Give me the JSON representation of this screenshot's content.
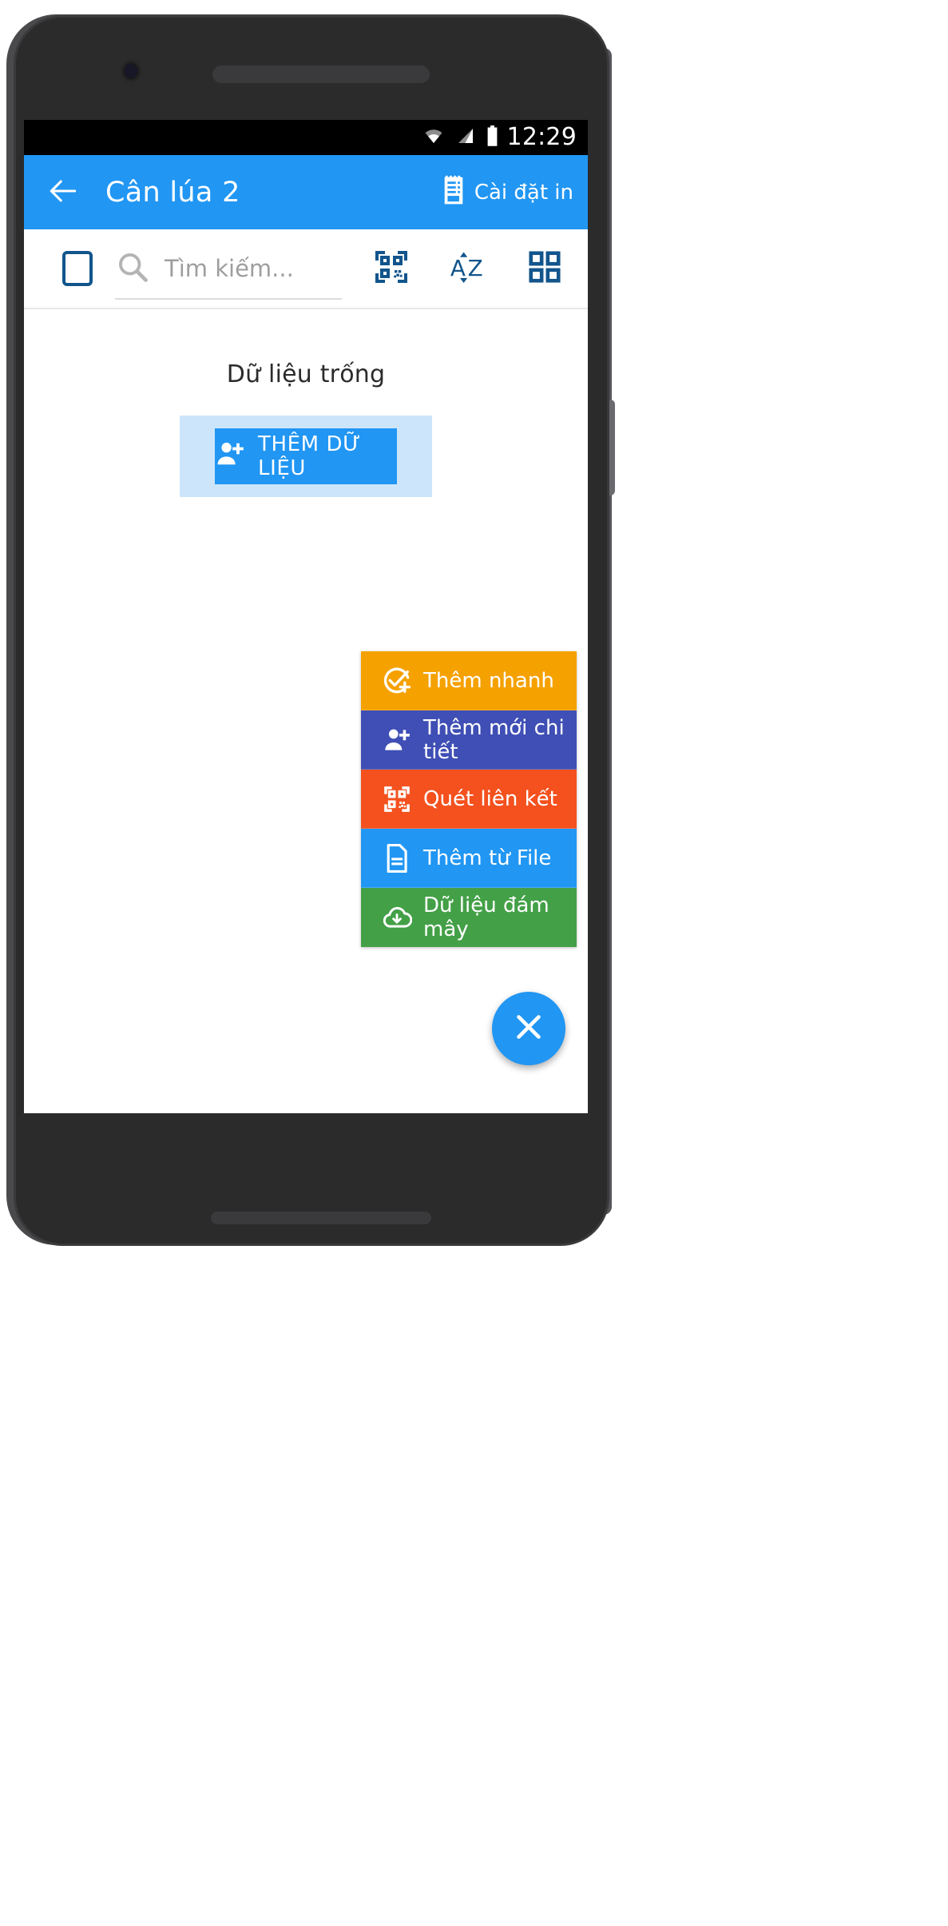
{
  "status_bar": {
    "time": "12:29",
    "icons": [
      "wifi-icon",
      "signal-icon",
      "battery-icon"
    ]
  },
  "app_bar": {
    "back_icon": "back-arrow-icon",
    "title": "Cân lúa 2",
    "action": {
      "icon": "receipt-printer-icon",
      "label": "Cài đặt in"
    },
    "background_color": "#2196f3"
  },
  "search_toolbar": {
    "select_all_checkbox": "",
    "search_icon": "search-icon",
    "search_value": "",
    "search_placeholder": "Tìm kiếm...",
    "actions": [
      {
        "name": "qr-scan-icon",
        "label": ""
      },
      {
        "name": "sort-az-icon",
        "label": ""
      },
      {
        "name": "grid-view-icon",
        "label": ""
      }
    ],
    "icon_color": "#12558c"
  },
  "empty_state": {
    "title": "Dữ liệu trống",
    "add_button_label": "THÊM DỮ LIỆU",
    "add_button_icon": "person-add-icon",
    "button_color": "#2196f3",
    "panel_color": "#cde5fb"
  },
  "speed_dial": {
    "items": [
      {
        "label": "Thêm nhanh",
        "icon": "check-circle-plus-icon",
        "color": "#f5a100"
      },
      {
        "label": "Thêm mới chi tiết",
        "icon": "person-add-icon",
        "color": "#3f4fb5"
      },
      {
        "label": "Quét liên kết",
        "icon": "qr-scan-icon",
        "color": "#f4511e"
      },
      {
        "label": "Thêm từ File",
        "icon": "file-document-icon",
        "color": "#2196f3"
      },
      {
        "label": "Dữ liệu đám mây",
        "icon": "cloud-download-icon",
        "color": "#43a047"
      }
    ],
    "fab_icon": "close-icon",
    "fab_color": "#2196f3"
  },
  "navigation_bar": {
    "buttons": [
      {
        "name": "nav-back-icon"
      },
      {
        "name": "nav-home-icon"
      },
      {
        "name": "nav-recents-icon"
      }
    ]
  }
}
